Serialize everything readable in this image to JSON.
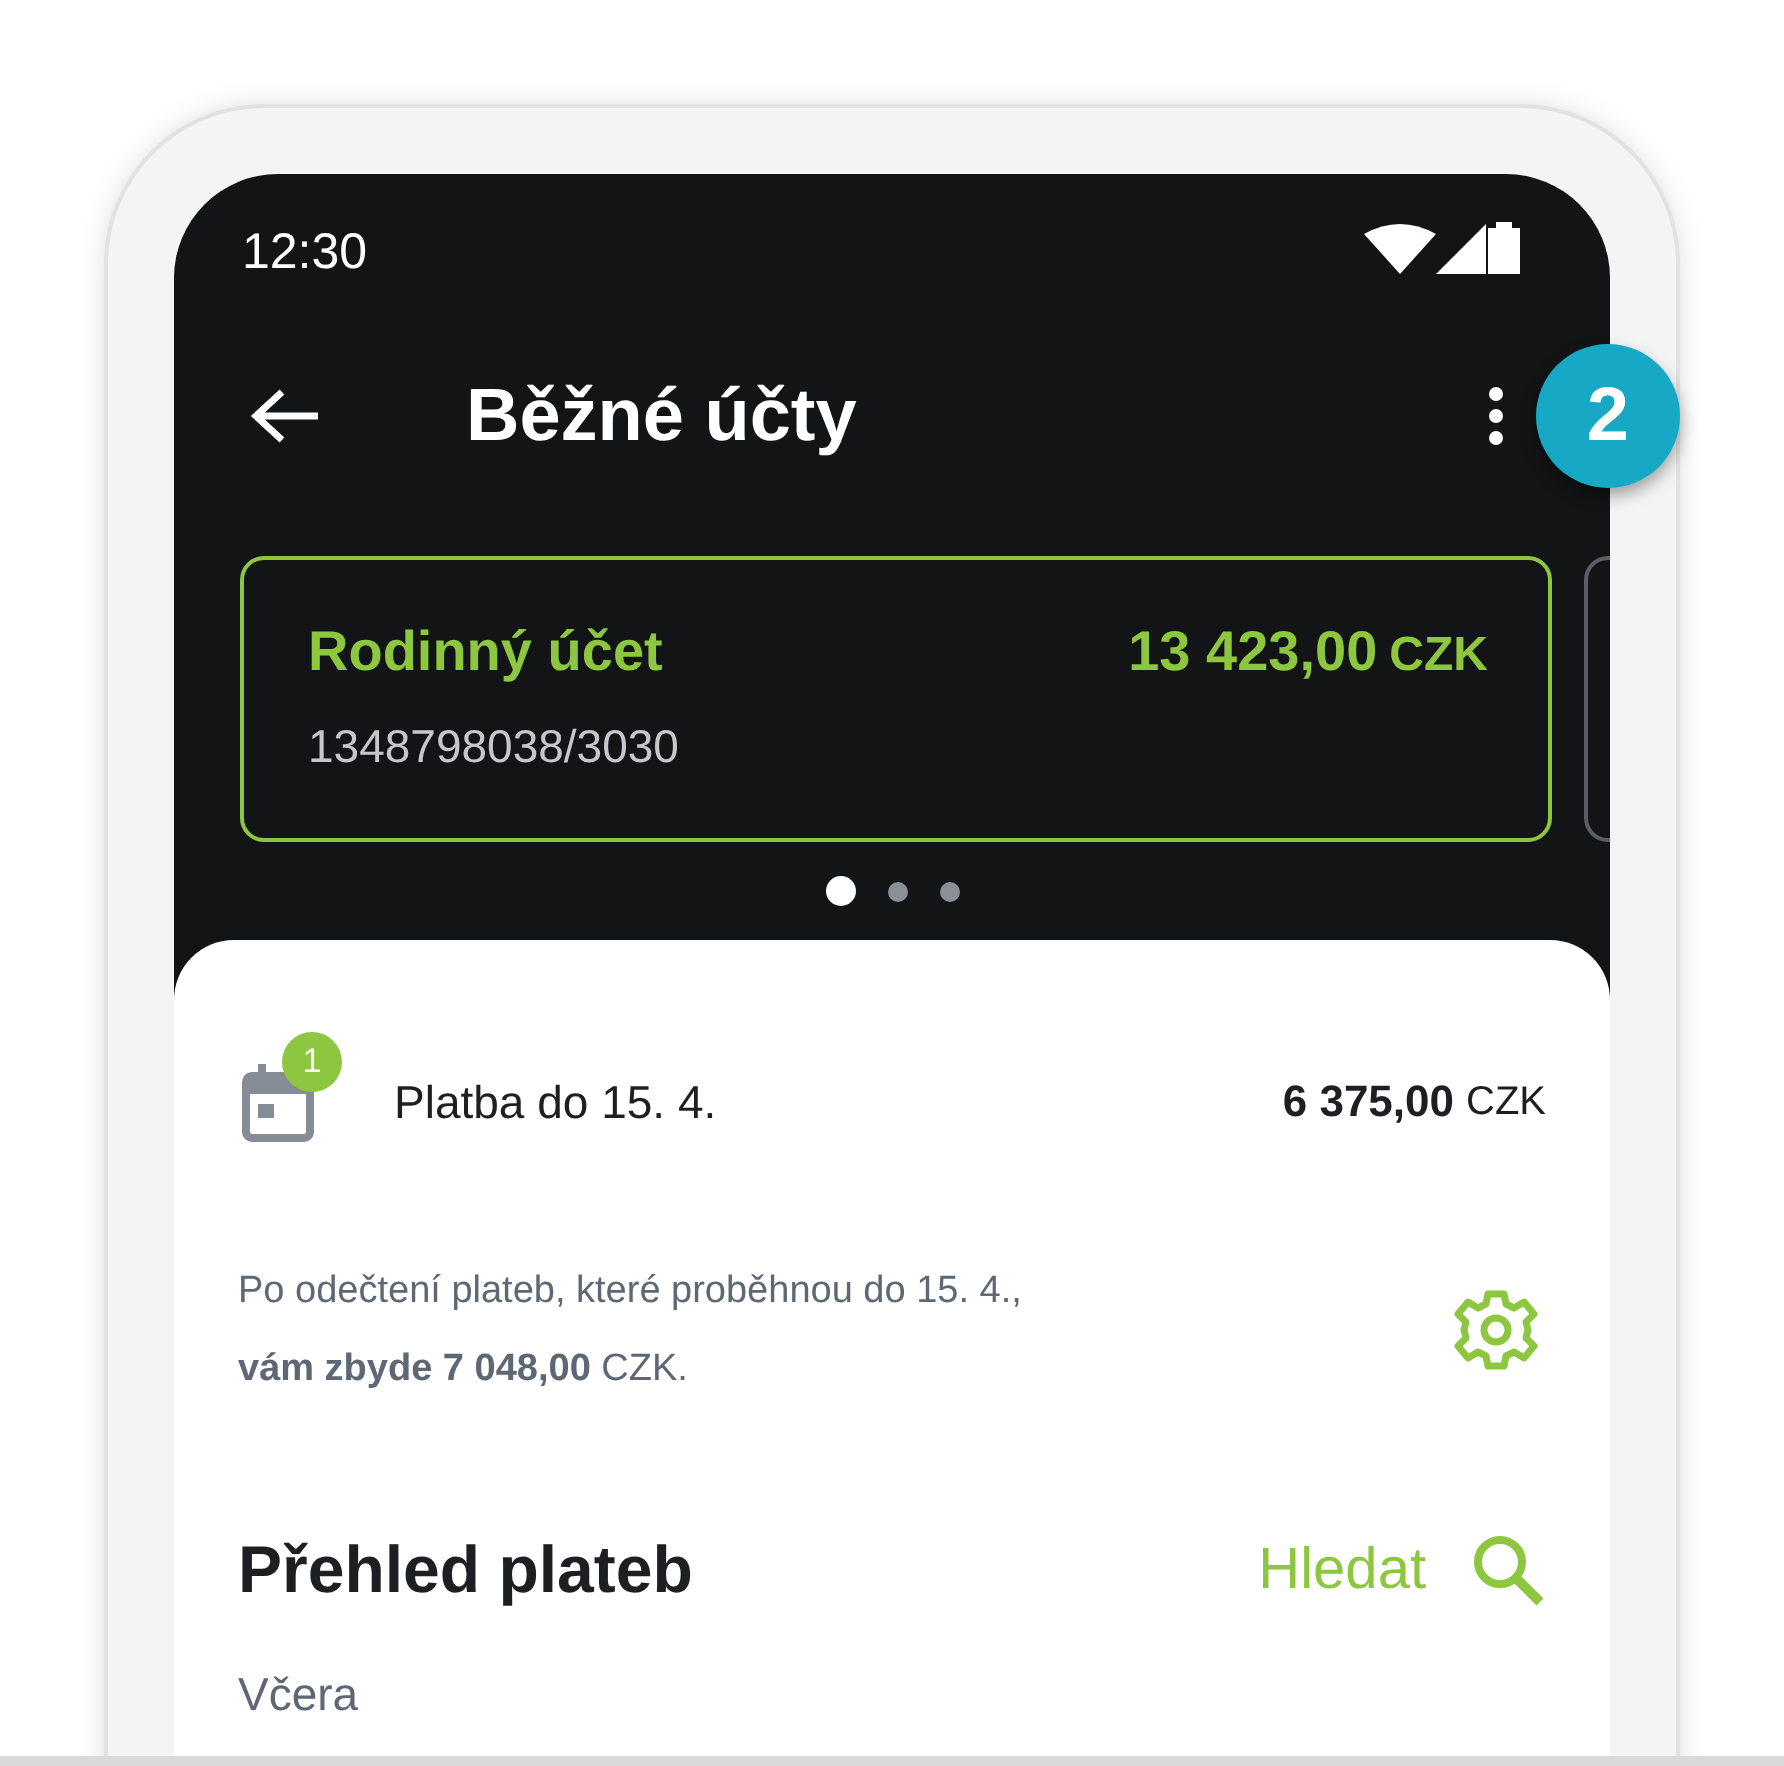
{
  "status_bar": {
    "time": "12:30"
  },
  "app_bar": {
    "title": "Běžné účty",
    "badge": "2"
  },
  "accounts": [
    {
      "name": "Rodinný účet",
      "amount": "13 423,00",
      "currency": "CZK",
      "number": "1348798038/3030",
      "selected": true
    }
  ],
  "pager": [
    {
      "selected": true
    },
    {
      "selected": false
    },
    {
      "selected": false
    }
  ],
  "upcoming": {
    "label": "Platba do 15. 4.",
    "count": "1",
    "amount": "6 375,00",
    "currency": "CZK"
  },
  "note": "Po odečtení plateb, které proběhnou do 15. 4., **vám zbyde 7 048,00** CZK.",
  "overview": {
    "title": "Přehled plateb",
    "search": "Hledat",
    "sections": [
      {
        "date": "Včera"
      }
    ]
  }
}
